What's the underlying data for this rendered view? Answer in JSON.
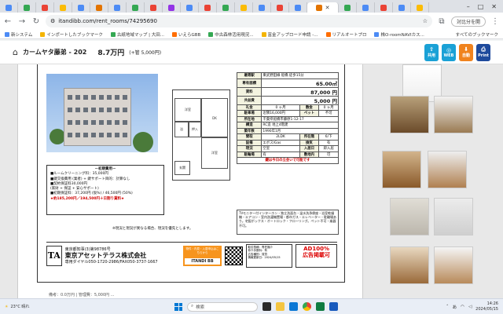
{
  "browser": {
    "url": "itandibb.com/rent_rooms/74295690",
    "profile_button": "対比分を開",
    "win_controls": [
      "–",
      "□",
      "✕"
    ],
    "bookmarks": [
      "新システム",
      "インポートしたブックマーク",
      "古紙地域マップ | 大田...",
      "いえらGBB",
      "中古森林活用現況...",
      "富金アップロード申請 -...",
      "リアルオートプロ",
      "株O-roomNAVIカス..."
    ],
    "all_bookmarks": "すべてのブックマーク"
  },
  "header": {
    "title": "カームヤタ藤弟 - 202",
    "rent": "8.7万円",
    "mgmt_fee": "(+管 5,000円)",
    "buttons": [
      {
        "label": "共用",
        "color": "#1aa1d6"
      },
      {
        "label": "WEB",
        "color": "#1aa1d6"
      },
      {
        "label": "自動",
        "color": "#f0831e"
      },
      {
        "label": "Print",
        "color": "#1e4a9c"
      }
    ]
  },
  "flyer": {
    "plan_label": "バルコニー",
    "rooms": [
      "洋室",
      "DK",
      "浴",
      "洋室",
      "押入",
      "玄関"
    ],
    "description": {
      "title": "－初期費用－",
      "lines": [
        "■ルームクリーニング料：35,000円",
        "■鍵交換費用 (業者) + 鍵サポート目的：計算なし",
        "■契約保証料30,000円",
        "(家財 + 保証 + 安心サポート)",
        "■初期保証料：37,200円 (仮%) / 46,500円 (50%)"
      ],
      "red_line": "★約185,200円／194,500円＋日割り賃料★"
    },
    "table": {
      "nearest_station_label": "最寄駅",
      "nearest_station": "東武野田線 船橋 徒歩15分",
      "area_label": "専有面積",
      "area": "65.00㎡",
      "rent_label": "賃料",
      "rent": "87,000 円",
      "common_label": "共益費",
      "common": "5,000 円",
      "deposit_row": [
        "礼金",
        "0 ヶ月",
        "敷金",
        "0 ヶ月"
      ],
      "parking_row": [
        "駐車場",
        "近隣16,000円",
        "ペット",
        "不可"
      ],
      "location_label": "所在地",
      "location": "千葉県船橋市藤原1-12-17",
      "structure_label": "構造",
      "structure": "RC造 地上4階建",
      "built_label": "築年数",
      "built": "1990年1月",
      "layout_row": [
        "間取",
        "2LDK",
        "所在階",
        "6/下"
      ],
      "detail_rows": [
        [
          "設備",
          "エボス/Gas",
          "換気",
          "有"
        ],
        [
          "現況",
          "空室",
          "入居日",
          "即入居"
        ],
        [
          "駐輪場",
          "有",
          "敷地内",
          "可"
        ]
      ],
      "red_note": "鍵は今日の立会いで可能です"
    },
    "notes": "TVモニター付インターホン・独立洗面台・温水洗浄便座・浴室乾燥機・エアコン・室内洗濯機置場・都市ガス・エレベーター・駐輪場あり。宅配ボックス・オートロック・フローリング。ペット不可・楽器不可。",
    "footer_note": "※現況と現況が異なる場合、現況を優先とします。",
    "company": {
      "license": "東京都知事(3)第98786号",
      "name": "東京アセットテラス株式会社",
      "tel": "専用ダイヤル050-1720-2986/FAX050-3737-1667",
      "itandi": "ITANDI BB",
      "itandi_note": "物件・内見・入居申込はこちらから",
      "ad_title": "AD100%",
      "ad_sub": "広告掲載可",
      "fee_lines": [
        "取引態様：専任媒介",
        "仲介手数料：有",
        "広告種別：賃貸",
        "情報更新日：2024/05/15"
      ]
    }
  },
  "bottom_strip": "備考：0.0万円 | 管理費：5,000円 ...",
  "taskbar": {
    "weather": "23°C 晴れ",
    "search": "検索",
    "time": "14:26",
    "date": "2024/05/15",
    "ime": "あ"
  }
}
